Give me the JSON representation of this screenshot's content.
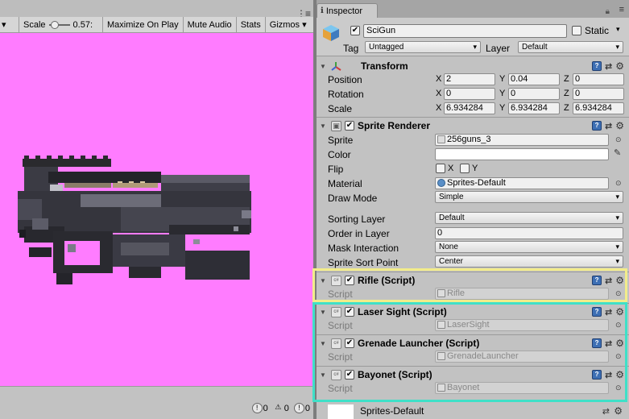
{
  "game": {
    "toolbar": {
      "scale_label": "Scale",
      "scale_value": "0.57:",
      "maximize_label": "Maximize On Play",
      "mute_label": "Mute Audio",
      "stats_label": "Stats",
      "gizmos_label": "Gizmos"
    },
    "background_color": "#ff7cff",
    "console": {
      "info_count": "0",
      "warning_count": "0",
      "error_count": "0"
    }
  },
  "inspector": {
    "tab_label": "Inspector",
    "object": {
      "active": true,
      "name": "SciGun",
      "static_label": "Static",
      "static_checked": false,
      "tag_label": "Tag",
      "tag_value": "Untagged",
      "layer_label": "Layer",
      "layer_value": "Default"
    },
    "transform": {
      "title": "Transform",
      "position_label": "Position",
      "rotation_label": "Rotation",
      "scale_label": "Scale",
      "x": "X",
      "y": "Y",
      "z": "Z",
      "position": {
        "x": "2",
        "y": "0.04",
        "z": "0"
      },
      "rotation": {
        "x": "0",
        "y": "0",
        "z": "0"
      },
      "scale": {
        "x": "6.934284",
        "y": "6.934284",
        "z": "6.934284"
      }
    },
    "sprite_renderer": {
      "title": "Sprite Renderer",
      "sprite_label": "Sprite",
      "sprite_value": "256guns_3",
      "color_label": "Color",
      "color_value": "#ffffff",
      "flip_label": "Flip",
      "flip_x": "X",
      "flip_y": "Y",
      "material_label": "Material",
      "material_value": "Sprites-Default",
      "draw_mode_label": "Draw Mode",
      "draw_mode_value": "Simple",
      "sorting_layer_label": "Sorting Layer",
      "sorting_layer_value": "Default",
      "order_label": "Order in Layer",
      "order_value": "0",
      "mask_label": "Mask Interaction",
      "mask_value": "None",
      "sort_point_label": "Sprite Sort Point",
      "sort_point_value": "Center"
    },
    "scripts": [
      {
        "title": "Rifle (Script)",
        "script_label": "Script",
        "script_value": "Rifle"
      },
      {
        "title": "Laser Sight (Script)",
        "script_label": "Script",
        "script_value": "LaserSight"
      },
      {
        "title": "Grenade Launcher (Script)",
        "script_label": "Script",
        "script_value": "GrenadeLauncher"
      },
      {
        "title": "Bayonet (Script)",
        "script_label": "Script",
        "script_value": "Bayonet"
      }
    ],
    "material_preview_name": "Sprites-Default"
  },
  "colors": {
    "highlight_yellow": "#f2ec8a",
    "highlight_teal": "#3fe0c8"
  }
}
